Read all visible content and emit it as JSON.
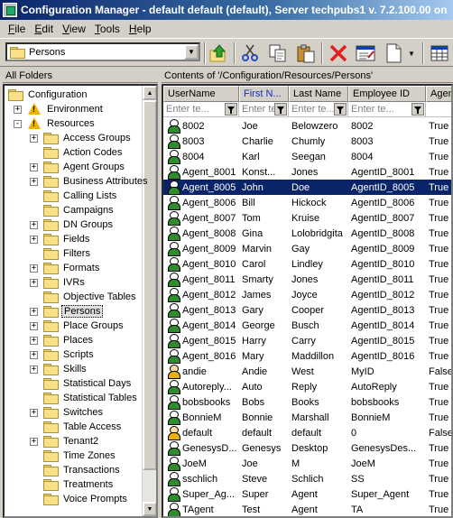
{
  "window": {
    "title": "Configuration Manager - default default (default), Server techpubs1 v. 7.2.100.00 on"
  },
  "menu": [
    "File",
    "Edit",
    "View",
    "Tools",
    "Help"
  ],
  "toolbar": {
    "folder_combo_value": "Persons",
    "buttons": [
      "up-folder-icon",
      "cut-icon",
      "copy-icon",
      "paste-icon",
      "delete-icon",
      "properties-icon",
      "new-object-icon",
      "new-object-dropdown-icon",
      "grid-view-icon"
    ]
  },
  "left_pane": {
    "header": "All Folders",
    "tree": [
      {
        "label": "Configuration",
        "level": 0,
        "icon": "folder-open",
        "expander": ""
      },
      {
        "label": "Environment",
        "level": 1,
        "icon": "warning",
        "expander": "+"
      },
      {
        "label": "Resources",
        "level": 1,
        "icon": "warning",
        "expander": "-"
      },
      {
        "label": "Access Groups",
        "level": 2,
        "icon": "folder",
        "expander": "+"
      },
      {
        "label": "Action Codes",
        "level": 2,
        "icon": "folder",
        "expander": ""
      },
      {
        "label": "Agent Groups",
        "level": 2,
        "icon": "folder",
        "expander": "+"
      },
      {
        "label": "Business Attributes",
        "level": 2,
        "icon": "folder",
        "expander": "+"
      },
      {
        "label": "Calling Lists",
        "level": 2,
        "icon": "folder",
        "expander": ""
      },
      {
        "label": "Campaigns",
        "level": 2,
        "icon": "folder",
        "expander": ""
      },
      {
        "label": "DN Groups",
        "level": 2,
        "icon": "folder",
        "expander": "+"
      },
      {
        "label": "Fields",
        "level": 2,
        "icon": "folder",
        "expander": "+"
      },
      {
        "label": "Filters",
        "level": 2,
        "icon": "folder",
        "expander": ""
      },
      {
        "label": "Formats",
        "level": 2,
        "icon": "folder",
        "expander": "+"
      },
      {
        "label": "IVRs",
        "level": 2,
        "icon": "folder",
        "expander": "+"
      },
      {
        "label": "Objective Tables",
        "level": 2,
        "icon": "folder",
        "expander": ""
      },
      {
        "label": "Persons",
        "level": 2,
        "icon": "folder",
        "expander": "+",
        "selected": true
      },
      {
        "label": "Place Groups",
        "level": 2,
        "icon": "folder",
        "expander": "+"
      },
      {
        "label": "Places",
        "level": 2,
        "icon": "folder",
        "expander": "+"
      },
      {
        "label": "Scripts",
        "level": 2,
        "icon": "folder",
        "expander": "+"
      },
      {
        "label": "Skills",
        "level": 2,
        "icon": "folder",
        "expander": "+"
      },
      {
        "label": "Statistical Days",
        "level": 2,
        "icon": "folder",
        "expander": ""
      },
      {
        "label": "Statistical Tables",
        "level": 2,
        "icon": "folder",
        "expander": ""
      },
      {
        "label": "Switches",
        "level": 2,
        "icon": "folder",
        "expander": "+"
      },
      {
        "label": "Table Access",
        "level": 2,
        "icon": "folder",
        "expander": ""
      },
      {
        "label": "Tenant2",
        "level": 2,
        "icon": "folder",
        "expander": "+"
      },
      {
        "label": "Time Zones",
        "level": 2,
        "icon": "folder",
        "expander": ""
      },
      {
        "label": "Transactions",
        "level": 2,
        "icon": "folder",
        "expander": ""
      },
      {
        "label": "Treatments",
        "level": 2,
        "icon": "folder",
        "expander": ""
      },
      {
        "label": "Voice Prompts",
        "level": 2,
        "icon": "folder",
        "expander": ""
      }
    ]
  },
  "right_pane": {
    "header": "Contents of '/Configuration/Resources/Persons'",
    "columns": [
      {
        "label": "UserName",
        "sorted": false
      },
      {
        "label": "First N...",
        "sorted": true
      },
      {
        "label": "Last Name",
        "sorted": false
      },
      {
        "label": "Employee ID",
        "sorted": false
      },
      {
        "label": "Agen",
        "sorted": false
      }
    ],
    "filter_placeholder": "Enter te...",
    "rows": [
      {
        "username": "8002",
        "first": "Joe",
        "last": "Belowzero",
        "employee_id": "8002",
        "agent": "True",
        "icon": "green"
      },
      {
        "username": "8003",
        "first": "Charlie",
        "last": "Chumly",
        "employee_id": "8003",
        "agent": "True",
        "icon": "green"
      },
      {
        "username": "8004",
        "first": "Karl",
        "last": "Seegan",
        "employee_id": "8004",
        "agent": "True",
        "icon": "green"
      },
      {
        "username": "Agent_8001",
        "first": "Konst...",
        "last": "Jones",
        "employee_id": "AgentID_8001",
        "agent": "True",
        "icon": "green"
      },
      {
        "username": "Agent_8005",
        "first": "John",
        "last": "Doe",
        "employee_id": "AgentID_8005",
        "agent": "True",
        "icon": "green",
        "selected": true
      },
      {
        "username": "Agent_8006",
        "first": "Bill",
        "last": "Hickock",
        "employee_id": "AgentID_8006",
        "agent": "True",
        "icon": "green"
      },
      {
        "username": "Agent_8007",
        "first": "Tom",
        "last": "Kruise",
        "employee_id": "AgentID_8007",
        "agent": "True",
        "icon": "green"
      },
      {
        "username": "Agent_8008",
        "first": "Gina",
        "last": "Lolobridgita",
        "employee_id": "AgentID_8008",
        "agent": "True",
        "icon": "green"
      },
      {
        "username": "Agent_8009",
        "first": "Marvin",
        "last": "Gay",
        "employee_id": "AgentID_8009",
        "agent": "True",
        "icon": "green"
      },
      {
        "username": "Agent_8010",
        "first": "Carol",
        "last": "Lindley",
        "employee_id": "AgentID_8010",
        "agent": "True",
        "icon": "green"
      },
      {
        "username": "Agent_8011",
        "first": "Smarty",
        "last": "Jones",
        "employee_id": "AgentID_8011",
        "agent": "True",
        "icon": "green"
      },
      {
        "username": "Agent_8012",
        "first": "James",
        "last": "Joyce",
        "employee_id": "AgentID_8012",
        "agent": "True",
        "icon": "green"
      },
      {
        "username": "Agent_8013",
        "first": "Gary",
        "last": "Cooper",
        "employee_id": "AgentID_8013",
        "agent": "True",
        "icon": "green"
      },
      {
        "username": "Agent_8014",
        "first": "George",
        "last": "Busch",
        "employee_id": "AgentID_8014",
        "agent": "True",
        "icon": "green"
      },
      {
        "username": "Agent_8015",
        "first": "Harry",
        "last": "Carry",
        "employee_id": "AgentID_8015",
        "agent": "True",
        "icon": "green"
      },
      {
        "username": "Agent_8016",
        "first": "Mary",
        "last": "Maddillon",
        "employee_id": "AgentID_8016",
        "agent": "True",
        "icon": "green"
      },
      {
        "username": "andie",
        "first": "Andie",
        "last": "West",
        "employee_id": "MyID",
        "agent": "False",
        "icon": "yellow"
      },
      {
        "username": "Autoreply...",
        "first": "Auto",
        "last": "Reply",
        "employee_id": "AutoReply",
        "agent": "True",
        "icon": "green"
      },
      {
        "username": "bobsbooks",
        "first": "Bobs",
        "last": "Books",
        "employee_id": "bobsbooks",
        "agent": "True",
        "icon": "green"
      },
      {
        "username": "BonnieM",
        "first": "Bonnie",
        "last": "Marshall",
        "employee_id": "BonnieM",
        "agent": "True",
        "icon": "green"
      },
      {
        "username": "default",
        "first": "default",
        "last": "default",
        "employee_id": "0",
        "agent": "False",
        "icon": "yellow"
      },
      {
        "username": "GenesysD...",
        "first": "Genesys",
        "last": "Desktop",
        "employee_id": "GenesysDes...",
        "agent": "True",
        "icon": "green"
      },
      {
        "username": "JoeM",
        "first": "Joe",
        "last": "M",
        "employee_id": "JoeM",
        "agent": "True",
        "icon": "green"
      },
      {
        "username": "sschlich",
        "first": "Steve",
        "last": "Schlich",
        "employee_id": "SS",
        "agent": "True",
        "icon": "green"
      },
      {
        "username": "Super_Ag...",
        "first": "Super",
        "last": "Agent",
        "employee_id": "Super_Agent",
        "agent": "True",
        "icon": "green"
      },
      {
        "username": "TAgent",
        "first": "Test",
        "last": "Agent",
        "employee_id": "TA",
        "agent": "True",
        "icon": "green"
      }
    ]
  },
  "colors": {
    "selection": "#0a246a",
    "sorted_header": "#1030c0",
    "window_bg": "#d4d0c8"
  }
}
